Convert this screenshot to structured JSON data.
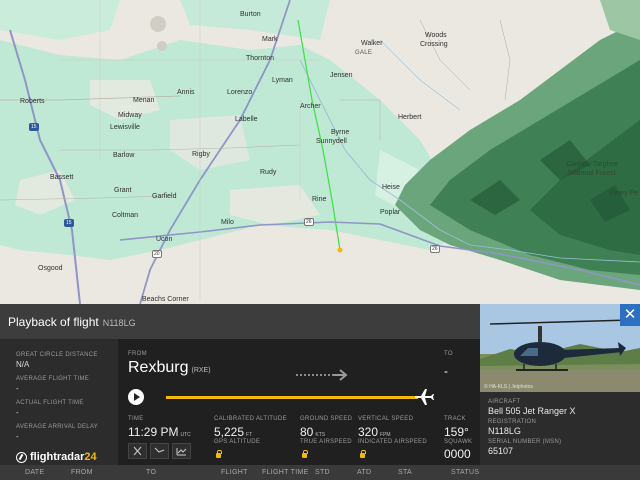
{
  "map": {
    "places": [
      {
        "name": "Burton",
        "cls": "town"
      },
      {
        "name": "Mark",
        "cls": "town"
      },
      {
        "name": "Walker",
        "cls": "town"
      },
      {
        "name": "Woods",
        "cls": "town"
      },
      {
        "name": "Crossing",
        "cls": "town"
      },
      {
        "name": "GALE",
        "cls": "cap"
      },
      {
        "name": "Thornton",
        "cls": "town"
      },
      {
        "name": "Lyman",
        "cls": "town"
      },
      {
        "name": "Jensen",
        "cls": "town"
      },
      {
        "name": "Roberts",
        "cls": "town"
      },
      {
        "name": "Menan",
        "cls": "town"
      },
      {
        "name": "Annis",
        "cls": "town"
      },
      {
        "name": "Lorenzo",
        "cls": "town"
      },
      {
        "name": "Archer",
        "cls": "town"
      },
      {
        "name": "Midway",
        "cls": "town"
      },
      {
        "name": "Labelle",
        "cls": "town"
      },
      {
        "name": "Lewisville",
        "cls": "town"
      },
      {
        "name": "Herbert",
        "cls": "town"
      },
      {
        "name": "Byrne",
        "cls": "town"
      },
      {
        "name": "Sunnydell",
        "cls": "town"
      },
      {
        "name": "Barlow",
        "cls": "town"
      },
      {
        "name": "Rigby",
        "cls": "town"
      },
      {
        "name": "Caribou-Targhee",
        "cls": "town"
      },
      {
        "name": "National Forest",
        "cls": "town"
      },
      {
        "name": "Rudy",
        "cls": "town"
      },
      {
        "name": "Bassett",
        "cls": "town"
      },
      {
        "name": "Heise",
        "cls": "town"
      },
      {
        "name": "Grant",
        "cls": "town"
      },
      {
        "name": "Garfield",
        "cls": "town"
      },
      {
        "name": "Rine",
        "cls": "town"
      },
      {
        "name": "Coltman",
        "cls": "town"
      },
      {
        "name": "Poplar",
        "cls": "town"
      },
      {
        "name": "Milo",
        "cls": "town"
      },
      {
        "name": "Ucon",
        "cls": "town"
      },
      {
        "name": "Osgood",
        "cls": "town"
      },
      {
        "name": "Beachs Corner",
        "cls": "town"
      },
      {
        "name": "Piney Pe",
        "cls": "town"
      }
    ],
    "shields": [
      {
        "label": "15",
        "cls": "interstate"
      },
      {
        "label": "15",
        "cls": "interstate"
      },
      {
        "label": "26",
        "cls": "us"
      },
      {
        "label": "26",
        "cls": "us"
      },
      {
        "label": "20",
        "cls": "us"
      }
    ],
    "colors": {
      "land": "#ebe8e1",
      "farm": "#bfe8d5",
      "forest": "#4c8f62",
      "track": "#3ee042",
      "road": "#8f96c6"
    }
  },
  "panel": {
    "title": "Playback of flight",
    "registration_header": "N118LG",
    "close_label": "✕",
    "left_stats": [
      {
        "label": "GREAT CIRCLE DISTANCE",
        "value": "N/A"
      },
      {
        "label": "AVERAGE FLIGHT TIME",
        "value": "-"
      },
      {
        "label": "ACTUAL FLIGHT TIME",
        "value": "-"
      },
      {
        "label": "AVERAGE ARRIVAL DELAY",
        "value": "-"
      }
    ],
    "logo": {
      "main": "flightradar",
      "accent": "24"
    },
    "route": {
      "from_label": "FROM",
      "from_city": "Rexburg",
      "from_code": "(RXE)",
      "to_label": "TO",
      "to_city": "-"
    },
    "progress": 0.87,
    "metrics": {
      "time": {
        "label": "TIME",
        "value": "11:29 PM",
        "unit": "UTC"
      },
      "cal_alt": {
        "label": "CALIBRATED ALTITUDE",
        "value": "5,225",
        "unit": "FT"
      },
      "gps_alt": {
        "label": "GPS ALTITUDE"
      },
      "ground_speed": {
        "label": "GROUND SPEED",
        "value": "80",
        "unit": "KTS"
      },
      "true_airspeed": {
        "label": "TRUE AIRSPEED"
      },
      "vert_speed": {
        "label": "VERTICAL SPEED",
        "value": "320",
        "unit": "FPM"
      },
      "ind_airspeed": {
        "label": "INDICATED AIRSPEED"
      },
      "track": {
        "label": "TRACK",
        "value": "159°"
      },
      "squawk": {
        "label": "SQUAWK",
        "value": "0000"
      }
    },
    "aircraft": {
      "aircraft_label": "AIRCRAFT",
      "aircraft_value": "Bell 505 Jet Ranger X",
      "reg_label": "REGISTRATION",
      "reg_value": "N118LG",
      "serial_label": "SERIAL NUMBER (MSN)",
      "serial_value": "65107",
      "photo_credit": "© HA-KLS | Jetphotos"
    }
  },
  "table_headers": [
    "DATE",
    "FROM",
    "TO",
    "FLIGHT",
    "FLIGHT TIME",
    "STD",
    "ATD",
    "STA",
    "STATUS"
  ]
}
